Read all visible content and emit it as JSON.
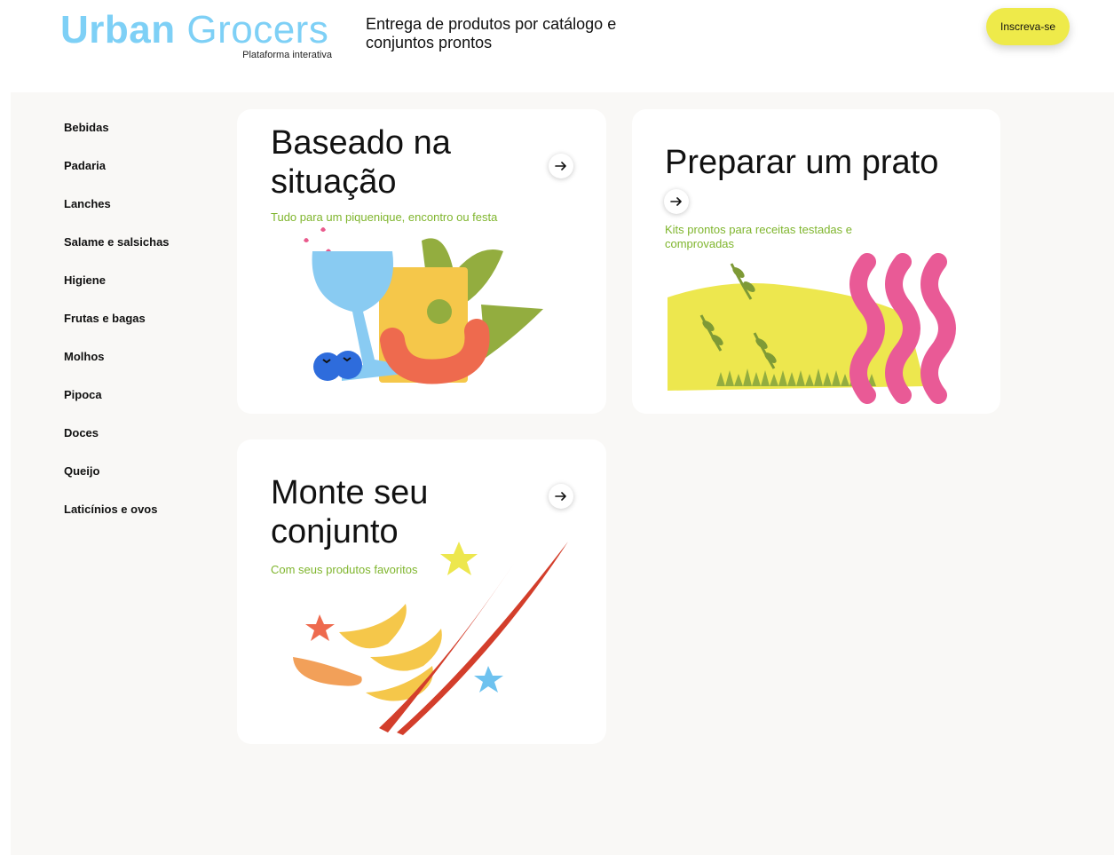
{
  "header": {
    "logo_bold": "Urban",
    "logo_light": "Grocers",
    "logo_subtitle": "Plataforma interativa",
    "tagline": "Entrega de produtos por catálogo e conjuntos prontos",
    "signup_label": "Inscreva-se"
  },
  "sidebar": {
    "items": [
      {
        "label": "Bebidas"
      },
      {
        "label": "Padaria"
      },
      {
        "label": "Lanches"
      },
      {
        "label": "Salame e salsichas"
      },
      {
        "label": "Higiene"
      },
      {
        "label": "Frutas e bagas"
      },
      {
        "label": "Molhos"
      },
      {
        "label": "Pipoca"
      },
      {
        "label": "Doces"
      },
      {
        "label": "Queijo"
      },
      {
        "label": "Laticínios e ovos"
      }
    ]
  },
  "cards": [
    {
      "title_line1": "Baseado na",
      "title_line2": "situação",
      "subtitle": "Tudo para um piquenique, encontro ou festa",
      "icon": "arrow-right-icon"
    },
    {
      "title": "Preparar um prato",
      "subtitle_line1": "Kits prontos para receitas testadas e",
      "subtitle_line2": "comprovadas",
      "icon": "arrow-right-icon"
    },
    {
      "title_line1": "Monte seu",
      "title_line2": "conjunto",
      "subtitle": "Com seus produtos favoritos",
      "icon": "arrow-right-icon"
    }
  ],
  "colors": {
    "brand_blue": "#7ed0f6",
    "accent_yellow": "#eeea4a",
    "subtitle_green": "#7fb52d",
    "background": "#f9f8f6"
  }
}
